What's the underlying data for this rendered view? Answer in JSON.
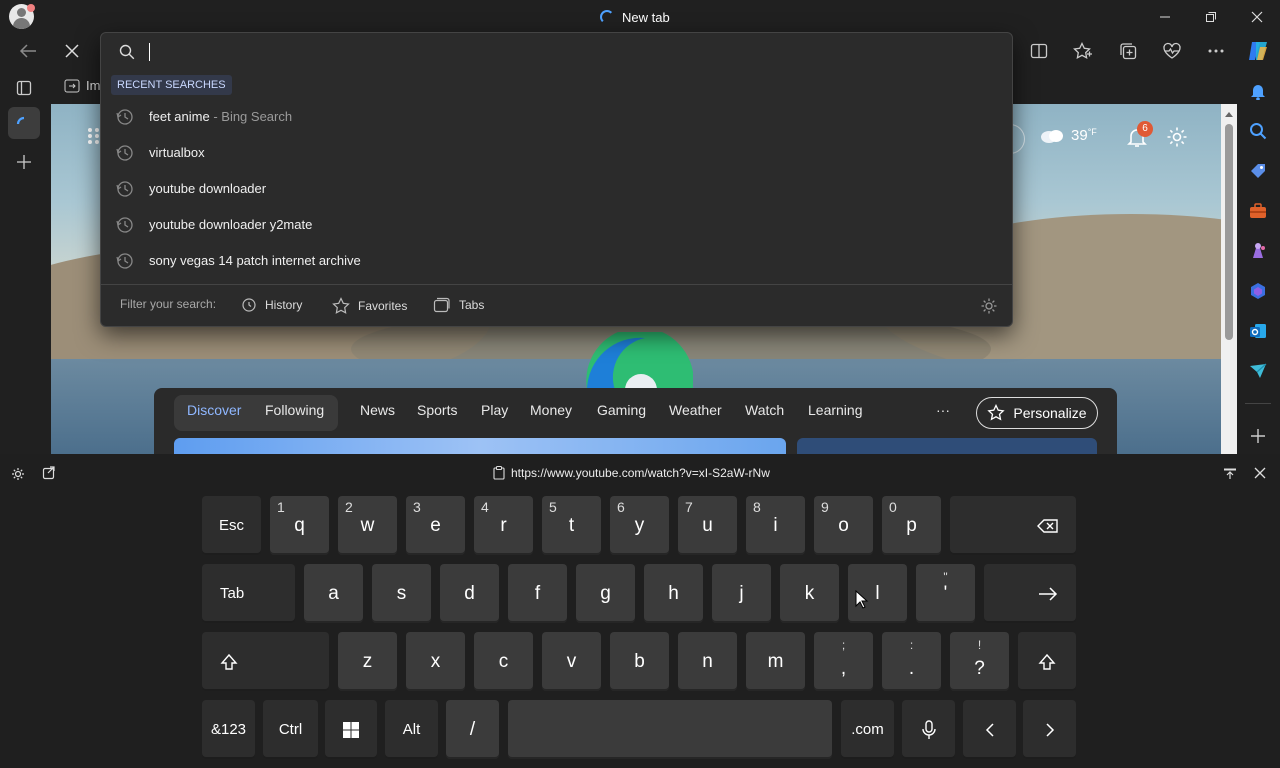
{
  "titlebar": {
    "tab_title": "New tab",
    "buttons": [
      "minimize-icon",
      "restore-icon",
      "close-icon"
    ]
  },
  "toolbar": {
    "favbar_label": "Im"
  },
  "search_dropdown": {
    "query": "",
    "section_header": "RECENT SEARCHES",
    "items": [
      {
        "text": "feet anime",
        "suffix": "- Bing Search"
      },
      {
        "text": "virtualbox",
        "suffix": ""
      },
      {
        "text": "youtube downloader",
        "suffix": ""
      },
      {
        "text": "youtube downloader y2mate",
        "suffix": ""
      },
      {
        "text": "sony vegas 14 patch internet archive",
        "suffix": ""
      }
    ],
    "filter_label": "Filter your search:",
    "filters": [
      "History",
      "Favorites",
      "Tabs"
    ]
  },
  "newtab": {
    "temperature": "39",
    "temp_unit": "°F",
    "notification_count": "6",
    "tabs": [
      "Discover",
      "Following"
    ],
    "nav_items": [
      "News",
      "Sports",
      "Play",
      "Money",
      "Gaming",
      "Weather",
      "Watch",
      "Learning"
    ],
    "more_label": "···",
    "personalize_label": "Personalize"
  },
  "keyboard": {
    "url": "https://www.youtube.com/watch?v=xI-S2aW-rNw",
    "row1": [
      {
        "label": "Esc",
        "sub": ""
      },
      {
        "label": "q",
        "sub": "1"
      },
      {
        "label": "w",
        "sub": "2"
      },
      {
        "label": "e",
        "sub": "3"
      },
      {
        "label": "r",
        "sub": "4"
      },
      {
        "label": "t",
        "sub": "5"
      },
      {
        "label": "y",
        "sub": "6"
      },
      {
        "label": "u",
        "sub": "7"
      },
      {
        "label": "i",
        "sub": "8"
      },
      {
        "label": "o",
        "sub": "9"
      },
      {
        "label": "p",
        "sub": "0"
      }
    ],
    "row2": [
      {
        "label": "Tab"
      },
      {
        "label": "a"
      },
      {
        "label": "s"
      },
      {
        "label": "d"
      },
      {
        "label": "f"
      },
      {
        "label": "g"
      },
      {
        "label": "h"
      },
      {
        "label": "j"
      },
      {
        "label": "k"
      },
      {
        "label": "l"
      },
      {
        "label": "'",
        "top": "\""
      }
    ],
    "row3": [
      {
        "label": "z"
      },
      {
        "label": "x"
      },
      {
        "label": "c"
      },
      {
        "label": "v"
      },
      {
        "label": "b"
      },
      {
        "label": "n"
      },
      {
        "label": "m"
      },
      {
        "label": ",",
        "top": ";"
      },
      {
        "label": ".",
        "top": ":"
      },
      {
        "label": "?",
        "top": "!"
      }
    ],
    "row4": {
      "num": "&123",
      "ctrl": "Ctrl",
      "alt": "Alt",
      "slash": "/",
      "dotcom": ".com"
    }
  },
  "colors": {
    "accent": "#4ea1ff",
    "keyboard_bg": "#1f1f1f",
    "key_bg": "#3b3b3b"
  }
}
